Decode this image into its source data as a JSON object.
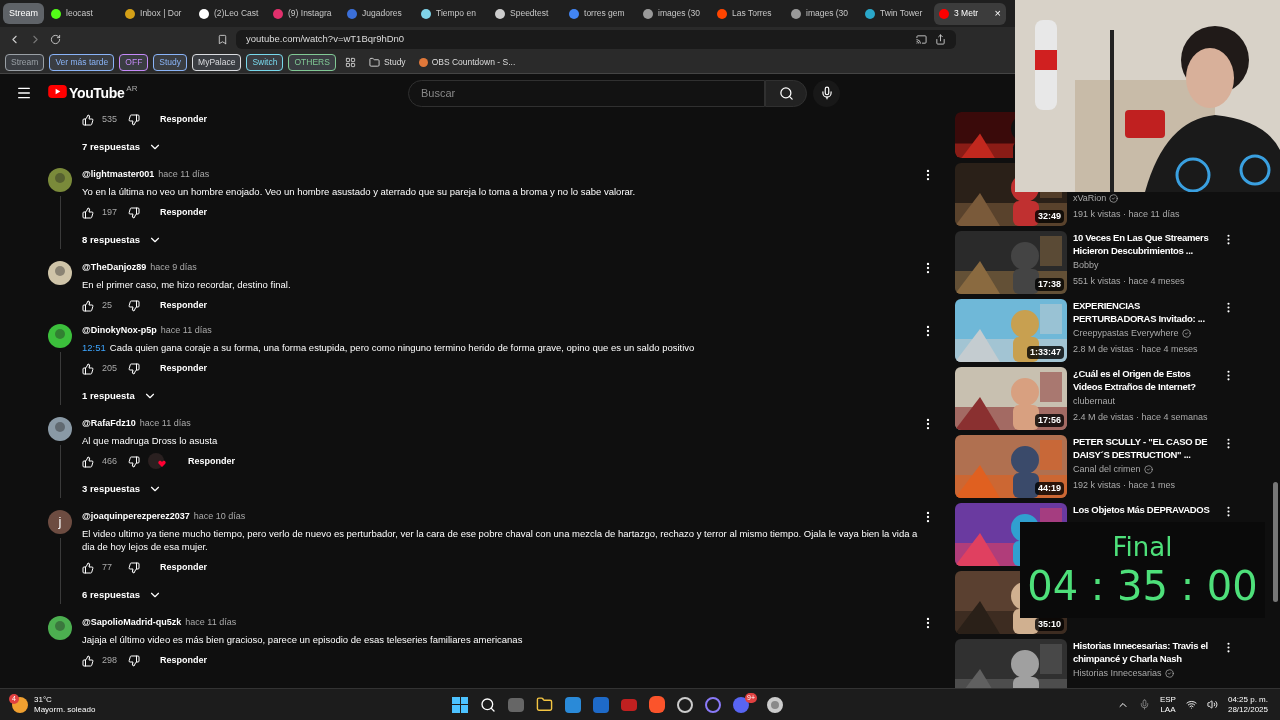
{
  "browser": {
    "tab_group": {
      "label": "Stream"
    },
    "tabs": [
      {
        "label": "leocast",
        "color": "#53fc18",
        "selected": false
      },
      {
        "label": "Inbox | Dor",
        "color": "#d4a017",
        "selected": false
      },
      {
        "label": "(2)Leo Cast",
        "color": "#ffffff",
        "selected": false
      },
      {
        "label": "(9) Instagra",
        "color": "#e1306c",
        "selected": false
      },
      {
        "label": "Jugadores",
        "color": "#3b6fd8",
        "selected": false
      },
      {
        "label": "Tiempo en",
        "color": "#7fd3e8",
        "selected": false
      },
      {
        "label": "Speedtest",
        "color": "#cccccc",
        "selected": false
      },
      {
        "label": "torres gem",
        "color": "#4285f4",
        "selected": false
      },
      {
        "label": "images (30",
        "color": "#9a9a9a",
        "selected": false
      },
      {
        "label": "Las Torres",
        "color": "#ff4500",
        "selected": false
      },
      {
        "label": "images (30",
        "color": "#9a9a9a",
        "selected": false
      },
      {
        "label": "Twin Tower",
        "color": "#2aa7c9",
        "selected": false
      },
      {
        "label": "3 Metr",
        "color": "#ff0000",
        "selected": true,
        "close": "×"
      }
    ],
    "url": "youtube.com/watch?v=wT1Bqr9hDn0",
    "bookmark_groups": [
      {
        "label": "Stream",
        "color": "#9aa0a6"
      },
      {
        "label": "Ver más tarde",
        "color": "#8ab4f8"
      },
      {
        "label": "OFF",
        "color": "#c58af9"
      },
      {
        "label": "Study",
        "color": "#8ab4f8"
      },
      {
        "label": "MyPalace",
        "color": "#dadce0"
      },
      {
        "label": "Switch",
        "color": "#78d9ec"
      },
      {
        "label": "OTHERS",
        "color": "#81c995"
      }
    ],
    "bookmarks": [
      {
        "kind": "folder",
        "label": "Study"
      },
      {
        "kind": "page",
        "label": "OBS Countdown - S..."
      }
    ]
  },
  "youtube": {
    "logo": "YouTube",
    "region": "AR",
    "search": {
      "placeholder": "Buscar"
    },
    "top_reply": {
      "likes": "535",
      "reply": "Responder",
      "replies": "7 respuestas"
    },
    "comments": [
      {
        "author": "@lightmaster001",
        "time": "hace 11 días",
        "text": "Yo en la última no veo un hombre enojado. Veo un hombre asustado y aterrado que su pareja lo toma a broma y no lo sabe valorar.",
        "likes": "197",
        "hearted": false,
        "reply": "Responder",
        "replies": "8 respuestas"
      },
      {
        "author": "@TheDanjoz89",
        "time": "hace 9 días",
        "text": "En el primer caso, me hizo recordar, destino final.",
        "likes": "25",
        "hearted": false,
        "reply": "Responder"
      },
      {
        "author": "@DinokyNox-p5p",
        "time": "hace 11 días",
        "timestamp": "12:51",
        "text": "Cada quien gana coraje a su forma, una forma estupida, pero como ninguno termino herido de forma grave, opino que es un saldo positivo",
        "likes": "205",
        "hearted": false,
        "reply": "Responder",
        "replies": "1 respuesta"
      },
      {
        "author": "@RafaFdz10",
        "time": "hace 11 días",
        "text": "Al que madruga Dross lo asusta",
        "likes": "466",
        "hearted": true,
        "reply": "Responder",
        "replies": "3 respuestas"
      },
      {
        "author": "@joaquinperezperez2037",
        "time": "hace 10 días",
        "avatar": {
          "kind": "letter",
          "letter": "j",
          "color": "#6d4c41"
        },
        "text": "El video ultimo ya tiene mucho tiempo, pero verlo de nuevo es perturbador, ver la cara de ese pobre chaval con una mezcla de hartazgo, rechazo y terror al mismo tiempo. Ojala le vaya bien la vida a dia de hoy lejos de esa mujer.",
        "likes": "77",
        "hearted": false,
        "reply": "Responder",
        "replies": "6 respuestas"
      },
      {
        "author": "@SapolioMadrid-qu5zk",
        "time": "hace 11 días",
        "text": "Jajaja el último video es más bien gracioso, parece un episodio de esas teleseries familiares americanas",
        "likes": "298",
        "hearted": false,
        "reply": "Responder"
      }
    ],
    "videos": [
      {
        "duration": "32:49",
        "channel": "xVaRion",
        "verified": true,
        "meta": "191 k vistas · hace 11 días"
      },
      {
        "title": "10 Veces En Las Que Streamers Hicieron Descubrimientos ...",
        "duration": "17:38",
        "channel": "Bobby",
        "verified": false,
        "meta": "551 k vistas · hace 4 meses"
      },
      {
        "title": "EXPERIENCIAS PERTURBADORAS Invitado: ...",
        "duration": "1:33:47",
        "channel": "Creepypastas Everywhere",
        "verified": true,
        "meta": "2.8 M de vistas · hace 4 meses"
      },
      {
        "title": "¿Cuál es el Origen de Estos Videos Extraños de Internet?",
        "duration": "17:56",
        "channel": "clubernaut",
        "verified": false,
        "meta": "2.4 M de vistas · hace 4 semanas"
      },
      {
        "title": "PETER SCULLY - \"EL CASO DE DAISY´S DESTRUCTION\" ...",
        "duration": "44:19",
        "channel": "Canal del crimen",
        "verified": true,
        "meta": "192 k vistas · hace 1 mes"
      },
      {
        "title": "Los Objetos Más DEPRAVADOS"
      },
      {
        "duration": "35:10"
      },
      {
        "title": "Historias Innecesarias: Travis el chimpancé y Charla Nash",
        "channel": "Historias Innecesarias",
        "verified": true
      }
    ]
  },
  "countdown": {
    "label": "Final",
    "time": "04 : 35 : 00"
  },
  "taskbar": {
    "weather": {
      "temp": "31°C",
      "text": "Mayorm. soleado",
      "badge": "4"
    },
    "discord_badge": "9+",
    "language": "ESP",
    "layout": "LAA",
    "time": "04:25 p. m.",
    "date": "28/12/2025"
  }
}
